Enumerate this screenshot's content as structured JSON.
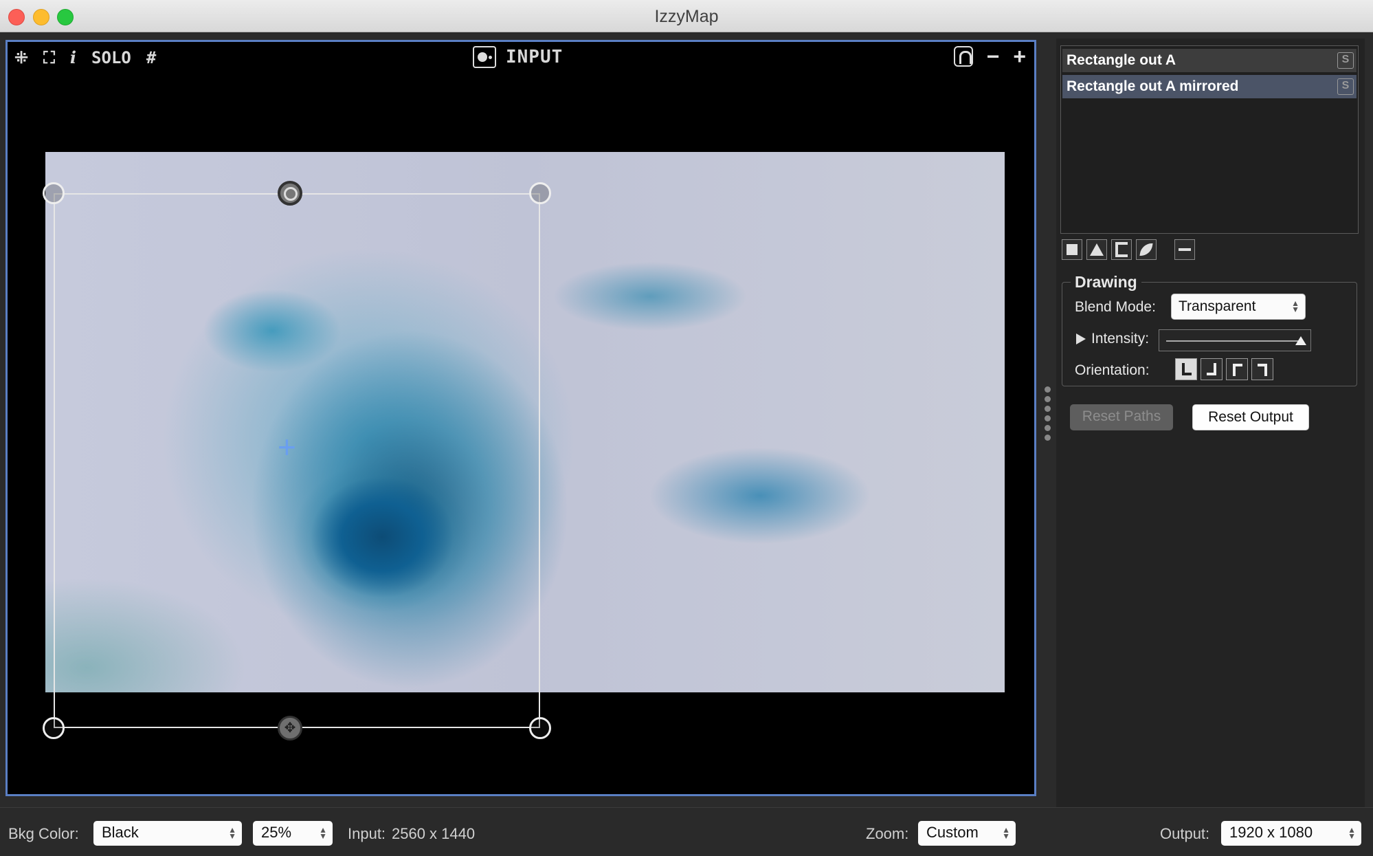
{
  "window": {
    "title": "IzzyMap"
  },
  "stage_toolbar": {
    "left_items": [
      "⁜",
      "⛶",
      "i",
      "SOLO",
      "#"
    ],
    "mode_label": "INPUT",
    "zoom_out": "−",
    "zoom_in": "+"
  },
  "shapes": {
    "items": [
      {
        "label": "Rectangle out A",
        "solo_badge": "S",
        "selected": false
      },
      {
        "label": "Rectangle out A mirrored",
        "solo_badge": "S",
        "selected": true
      }
    ]
  },
  "drawing": {
    "group_title": "Drawing",
    "blend_mode_label": "Blend Mode:",
    "blend_mode_value": "Transparent",
    "intensity_label": "Intensity:",
    "intensity_value": 1.0,
    "orientation_label": "Orientation:"
  },
  "actions": {
    "reset_paths": "Reset Paths",
    "reset_output": "Reset Output"
  },
  "bottom_bar": {
    "bkg_color_label": "Bkg Color:",
    "bkg_color_value": "Black",
    "opacity_value": "25%",
    "input_label": "Input:",
    "input_value": "2560 x 1440",
    "zoom_label": "Zoom:",
    "zoom_value": "Custom",
    "output_label": "Output:",
    "output_value": "1920 x 1080"
  },
  "colors": {
    "stage_border": "#5a7fc4",
    "selected_row": "#4b5467",
    "panel_bg": "#232323"
  },
  "icons": {
    "stage_toolbar": [
      "collapse-icon",
      "fullscreen-icon",
      "info-icon",
      "solo-toggle",
      "grid-icon"
    ],
    "shape_tools": [
      "add-rectangle-icon",
      "add-triangle-icon",
      "add-bracket-shape-icon",
      "add-curve-shape-icon",
      "delete-shape-icon"
    ],
    "orientation": [
      "orientation-bottom-left-icon",
      "orientation-bottom-right-icon",
      "orientation-top-left-icon",
      "orientation-top-right-icon"
    ]
  }
}
